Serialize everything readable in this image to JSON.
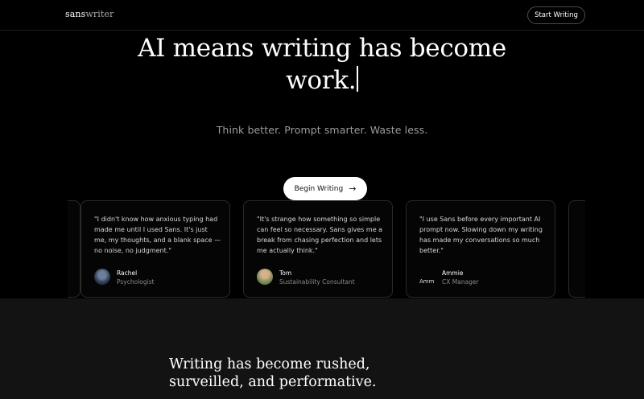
{
  "header": {
    "logo_part1": "sans",
    "logo_part2": "writer",
    "start_button": "Start Writing"
  },
  "hero": {
    "title_line1": "AI means writing has become",
    "title_line2": "work.",
    "subtitle": "Think better. Prompt smarter. Waste less.",
    "cta_label": "Begin Writing"
  },
  "testimonials": [
    {
      "quote": "\"I didn't know how anxious typing had made me until I used Sans. It's just me, my thoughts, and a blank space — no noise, no judgment.\"",
      "name": "Rachel",
      "role": "Psychologist"
    },
    {
      "quote": "\"It's strange how something so simple can feel so necessary. Sans gives me a break from chasing perfection and lets me actually think.\"",
      "name": "Tom",
      "role": "Sustainability Consultant"
    },
    {
      "quote": "\"I use Sans before every important AI prompt now. Slowing down my writing has made my conversations so much better.\"",
      "name": "Ammie",
      "role": "CX Manager",
      "avatar_alt": "Amm"
    }
  ],
  "section2": {
    "title": "Writing has become rushed, surveilled, and performative."
  }
}
